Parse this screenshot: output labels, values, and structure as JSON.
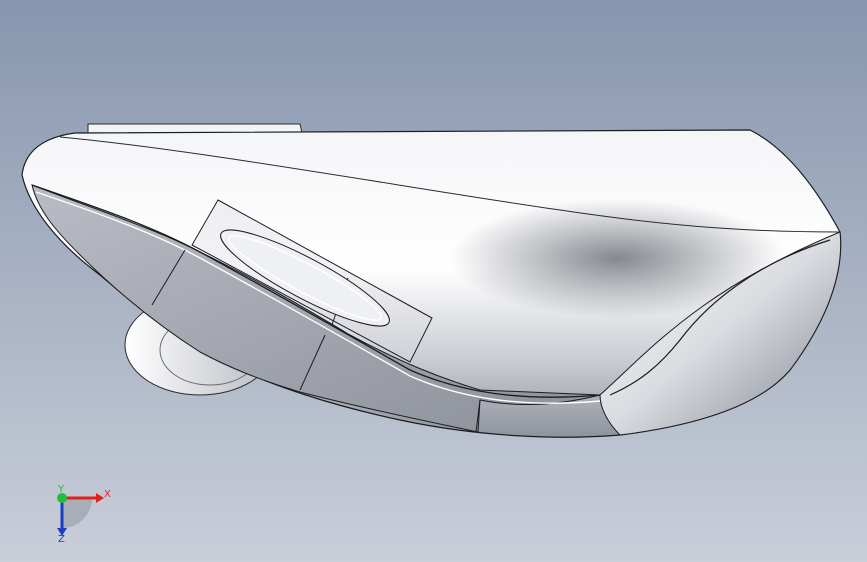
{
  "colors": {
    "background_top": "#8796ae",
    "background_bottom": "#c9ced9",
    "model_highlight": "#ffffff",
    "model_mid": "#bfc2c9",
    "model_shadow": "#5c6069",
    "edge_line": "#1b1c20",
    "axis_x": "#e0211b",
    "axis_y": "#1fbf3b",
    "axis_z": "#1e3cc4"
  },
  "triad": {
    "x_label": "X",
    "y_label": "Y",
    "z_label": "Z"
  }
}
